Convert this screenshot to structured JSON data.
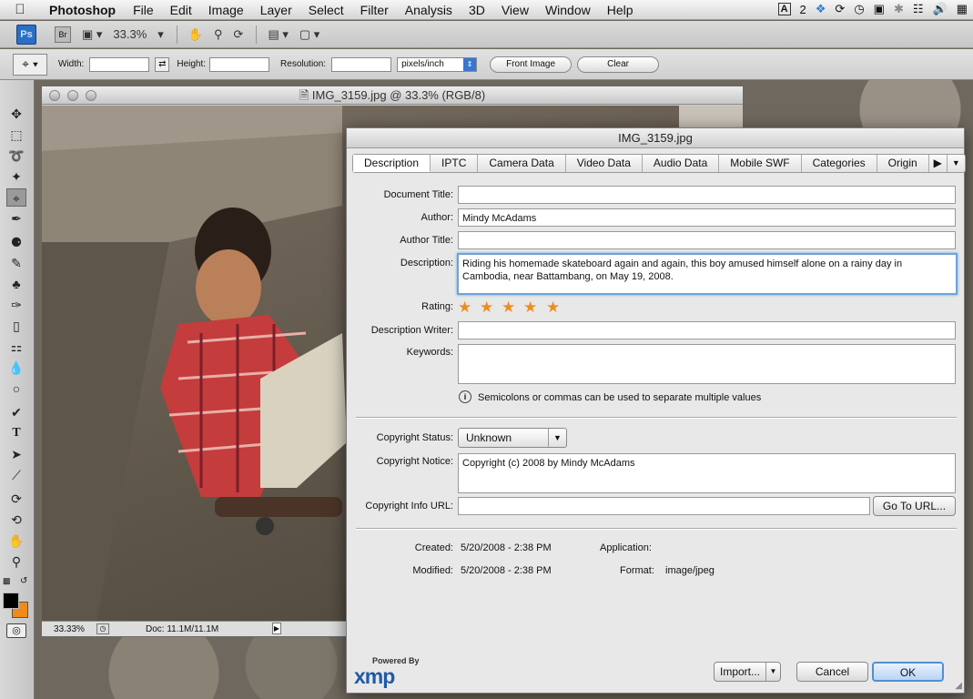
{
  "menubar": {
    "app": "Photoshop",
    "items": [
      "File",
      "Edit",
      "Image",
      "Layer",
      "Select",
      "Filter",
      "Analysis",
      "3D",
      "View",
      "Window",
      "Help"
    ],
    "status_badge": "2"
  },
  "appbar": {
    "ps": "Ps",
    "br": "Br",
    "zoom": "33.3%"
  },
  "options": {
    "width_label": "Width:",
    "height_label": "Height:",
    "resolution_label": "Resolution:",
    "units": "pixels/inch",
    "front_image": "Front Image",
    "clear": "Clear"
  },
  "document": {
    "title": "IMG_3159.jpg @ 33.3% (RGB/8)",
    "zoom": "33.33%",
    "doc_info": "Doc: 11.1M/11.1M"
  },
  "dialog": {
    "title": "IMG_3159.jpg",
    "tabs": [
      "Description",
      "IPTC",
      "Camera Data",
      "Video Data",
      "Audio Data",
      "Mobile SWF",
      "Categories",
      "Origin"
    ],
    "fields": {
      "document_title_label": "Document Title:",
      "document_title": "",
      "author_label": "Author:",
      "author": "Mindy McAdams",
      "author_title_label": "Author Title:",
      "author_title": "",
      "description_label": "Description:",
      "description": "Riding his homemade skateboard again and again, this boy amused himself alone on a rainy day in Cambodia, near Battambang, on May 19, 2008.",
      "rating_label": "Rating:",
      "rating": 5,
      "description_writer_label": "Description Writer:",
      "description_writer": "",
      "keywords_label": "Keywords:",
      "keywords": "",
      "keywords_hint": "Semicolons or commas can be used to separate multiple values",
      "copyright_status_label": "Copyright Status:",
      "copyright_status": "Unknown",
      "copyright_notice_label": "Copyright Notice:",
      "copyright_notice": "Copyright (c) 2008 by Mindy McAdams",
      "copyright_url_label": "Copyright Info URL:",
      "copyright_url": "",
      "go_to_url": "Go To URL..."
    },
    "info": {
      "created_label": "Created:",
      "created": "5/20/2008 - 2:38 PM",
      "modified_label": "Modified:",
      "modified": "5/20/2008 - 2:38 PM",
      "application_label": "Application:",
      "application": "",
      "format_label": "Format:",
      "format": "image/jpeg"
    },
    "footer": {
      "powered_by": "Powered By",
      "xmp": "xmp",
      "import": "Import...",
      "cancel": "Cancel",
      "ok": "OK"
    }
  }
}
